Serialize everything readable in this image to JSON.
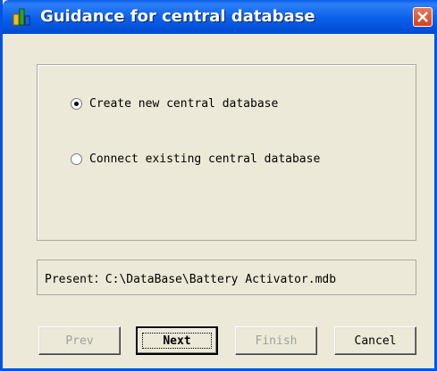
{
  "window": {
    "title": "Guidance for central database",
    "colors": {
      "titlebar": "#0A5FEA",
      "face": "#ECE9D8",
      "close": "#D2431F"
    }
  },
  "options": [
    {
      "label": "Create new central database",
      "selected": true
    },
    {
      "label": "Connect existing central database",
      "selected": false
    }
  ],
  "present_path": "Present：C:\\DataBase\\Battery Activator.mdb",
  "buttons": {
    "prev": "Prev",
    "next": "Next",
    "finish": "Finish",
    "cancel": "Cancel"
  }
}
